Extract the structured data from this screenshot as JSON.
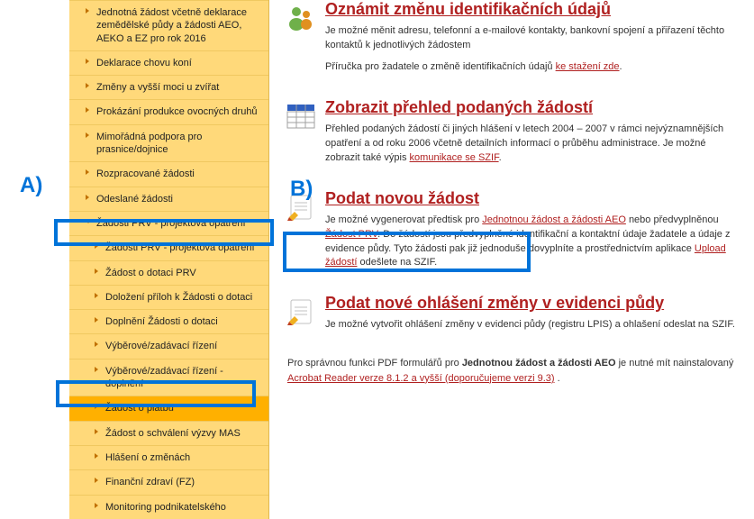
{
  "sidebar": {
    "items": [
      {
        "label": "Jednotná žádost včetně deklarace zemědělské půdy a žádosti AEO, AEKO a EZ pro rok 2016",
        "sub": false,
        "expanded": false
      },
      {
        "label": "Deklarace chovu koní",
        "sub": false,
        "expanded": false
      },
      {
        "label": "Změny a vyšší moci u zvířat",
        "sub": false,
        "expanded": false
      },
      {
        "label": "Prokázání produkce ovocných druhů",
        "sub": false,
        "expanded": false
      },
      {
        "label": "Mimořádná podpora pro prasnice/dojnice",
        "sub": false,
        "expanded": false
      },
      {
        "label": "Rozpracované žádosti",
        "sub": false,
        "expanded": false
      },
      {
        "label": "Odeslané žádosti",
        "sub": false,
        "expanded": false
      },
      {
        "label": "Žádosti PRV - projektová opatření",
        "sub": false,
        "expanded": true
      },
      {
        "label": "Žádosti PRV - projektová opatření",
        "sub": true,
        "expanded": false
      },
      {
        "label": "Žádost o dotaci PRV",
        "sub": true,
        "expanded": false
      },
      {
        "label": "Doložení příloh k Žádosti o dotaci",
        "sub": true,
        "expanded": false
      },
      {
        "label": "Doplnění Žádosti o dotaci",
        "sub": true,
        "expanded": false
      },
      {
        "label": "Výběrové/zadávací řízení",
        "sub": true,
        "expanded": false
      },
      {
        "label": "Výběrové/zadávací řízení - doplnění",
        "sub": true,
        "expanded": false
      },
      {
        "label": "Žádost o platbu",
        "sub": true,
        "expanded": false,
        "chosen": true
      },
      {
        "label": "Žádost o schválení výzvy MAS",
        "sub": true,
        "expanded": false
      },
      {
        "label": "Hlášení o změnách",
        "sub": true,
        "expanded": false
      },
      {
        "label": "Finanční zdraví (FZ)",
        "sub": true,
        "expanded": false
      },
      {
        "label": "Monitoring podnikatelského",
        "sub": true,
        "expanded": false
      }
    ]
  },
  "main": {
    "block1": {
      "title": "Oznámit změnu identifikačních údajů",
      "p1": "Je možné měnit adresu, telefonní a e-mailové kontakty, bankovní spojení a přiřazení těchto kontaktů k jednotlivých žádostem",
      "p2": "Příručka pro žadatele o změně identifikačních údajů",
      "link2": "ke stažení zde"
    },
    "block2": {
      "title": "Zobrazit přehled podaných žádostí",
      "p1a": "Přehled podaných žádostí či jiných hlášení v letech 2004 – 2007 v rámci nejvýznamnějších opatření a od roku 2006 včetně detailních informací o průběhu administrace.  Je možné zobrazit také výpis",
      "link1": "komunikace se SZIF"
    },
    "block3": {
      "title": "Podat novou žádost",
      "p1a": "Je možné vygenerovat předtisk pro",
      "link1": "Jednotnou žádost a žádosti AEO",
      "p1b": "nebo předvyplněnou",
      "link2": "Žádost PRV",
      "p1c": ". Do žádostí jsou předvyplněné identifikační a kontaktní údaje žadatele a údaje z evidence půdy. Tyto žádosti pak již jednoduše dovyplníte a prostřednictvím aplikace",
      "link3": "Upload žádostí",
      "p1d": "odešlete na SZIF."
    },
    "block4": {
      "title": "Podat nové ohlášení změny v evidenci půdy",
      "p1": "Je možné vytvořit ohlášení změny v evidenci půdy (registru LPIS) a ohlašení odeslat na SZIF."
    },
    "foot": {
      "t1": "Pro správnou funkci PDF formulářů pro",
      "bold": "Jednotnou žádost a žádosti AEO",
      "t2": "je nutné mít nainstalovaný",
      "link": "Acrobat Reader verze 8.1.2 a vyšší (doporučujeme verzi 9.3)",
      "t3": " ."
    }
  },
  "annotations": {
    "A": "A)",
    "B": "B)"
  },
  "colors": {
    "accent_red": "#b02020",
    "sidebar_bg": "#ffd97a",
    "sidebar_sel": "#ffb000",
    "anno_blue": "#0073d9"
  }
}
